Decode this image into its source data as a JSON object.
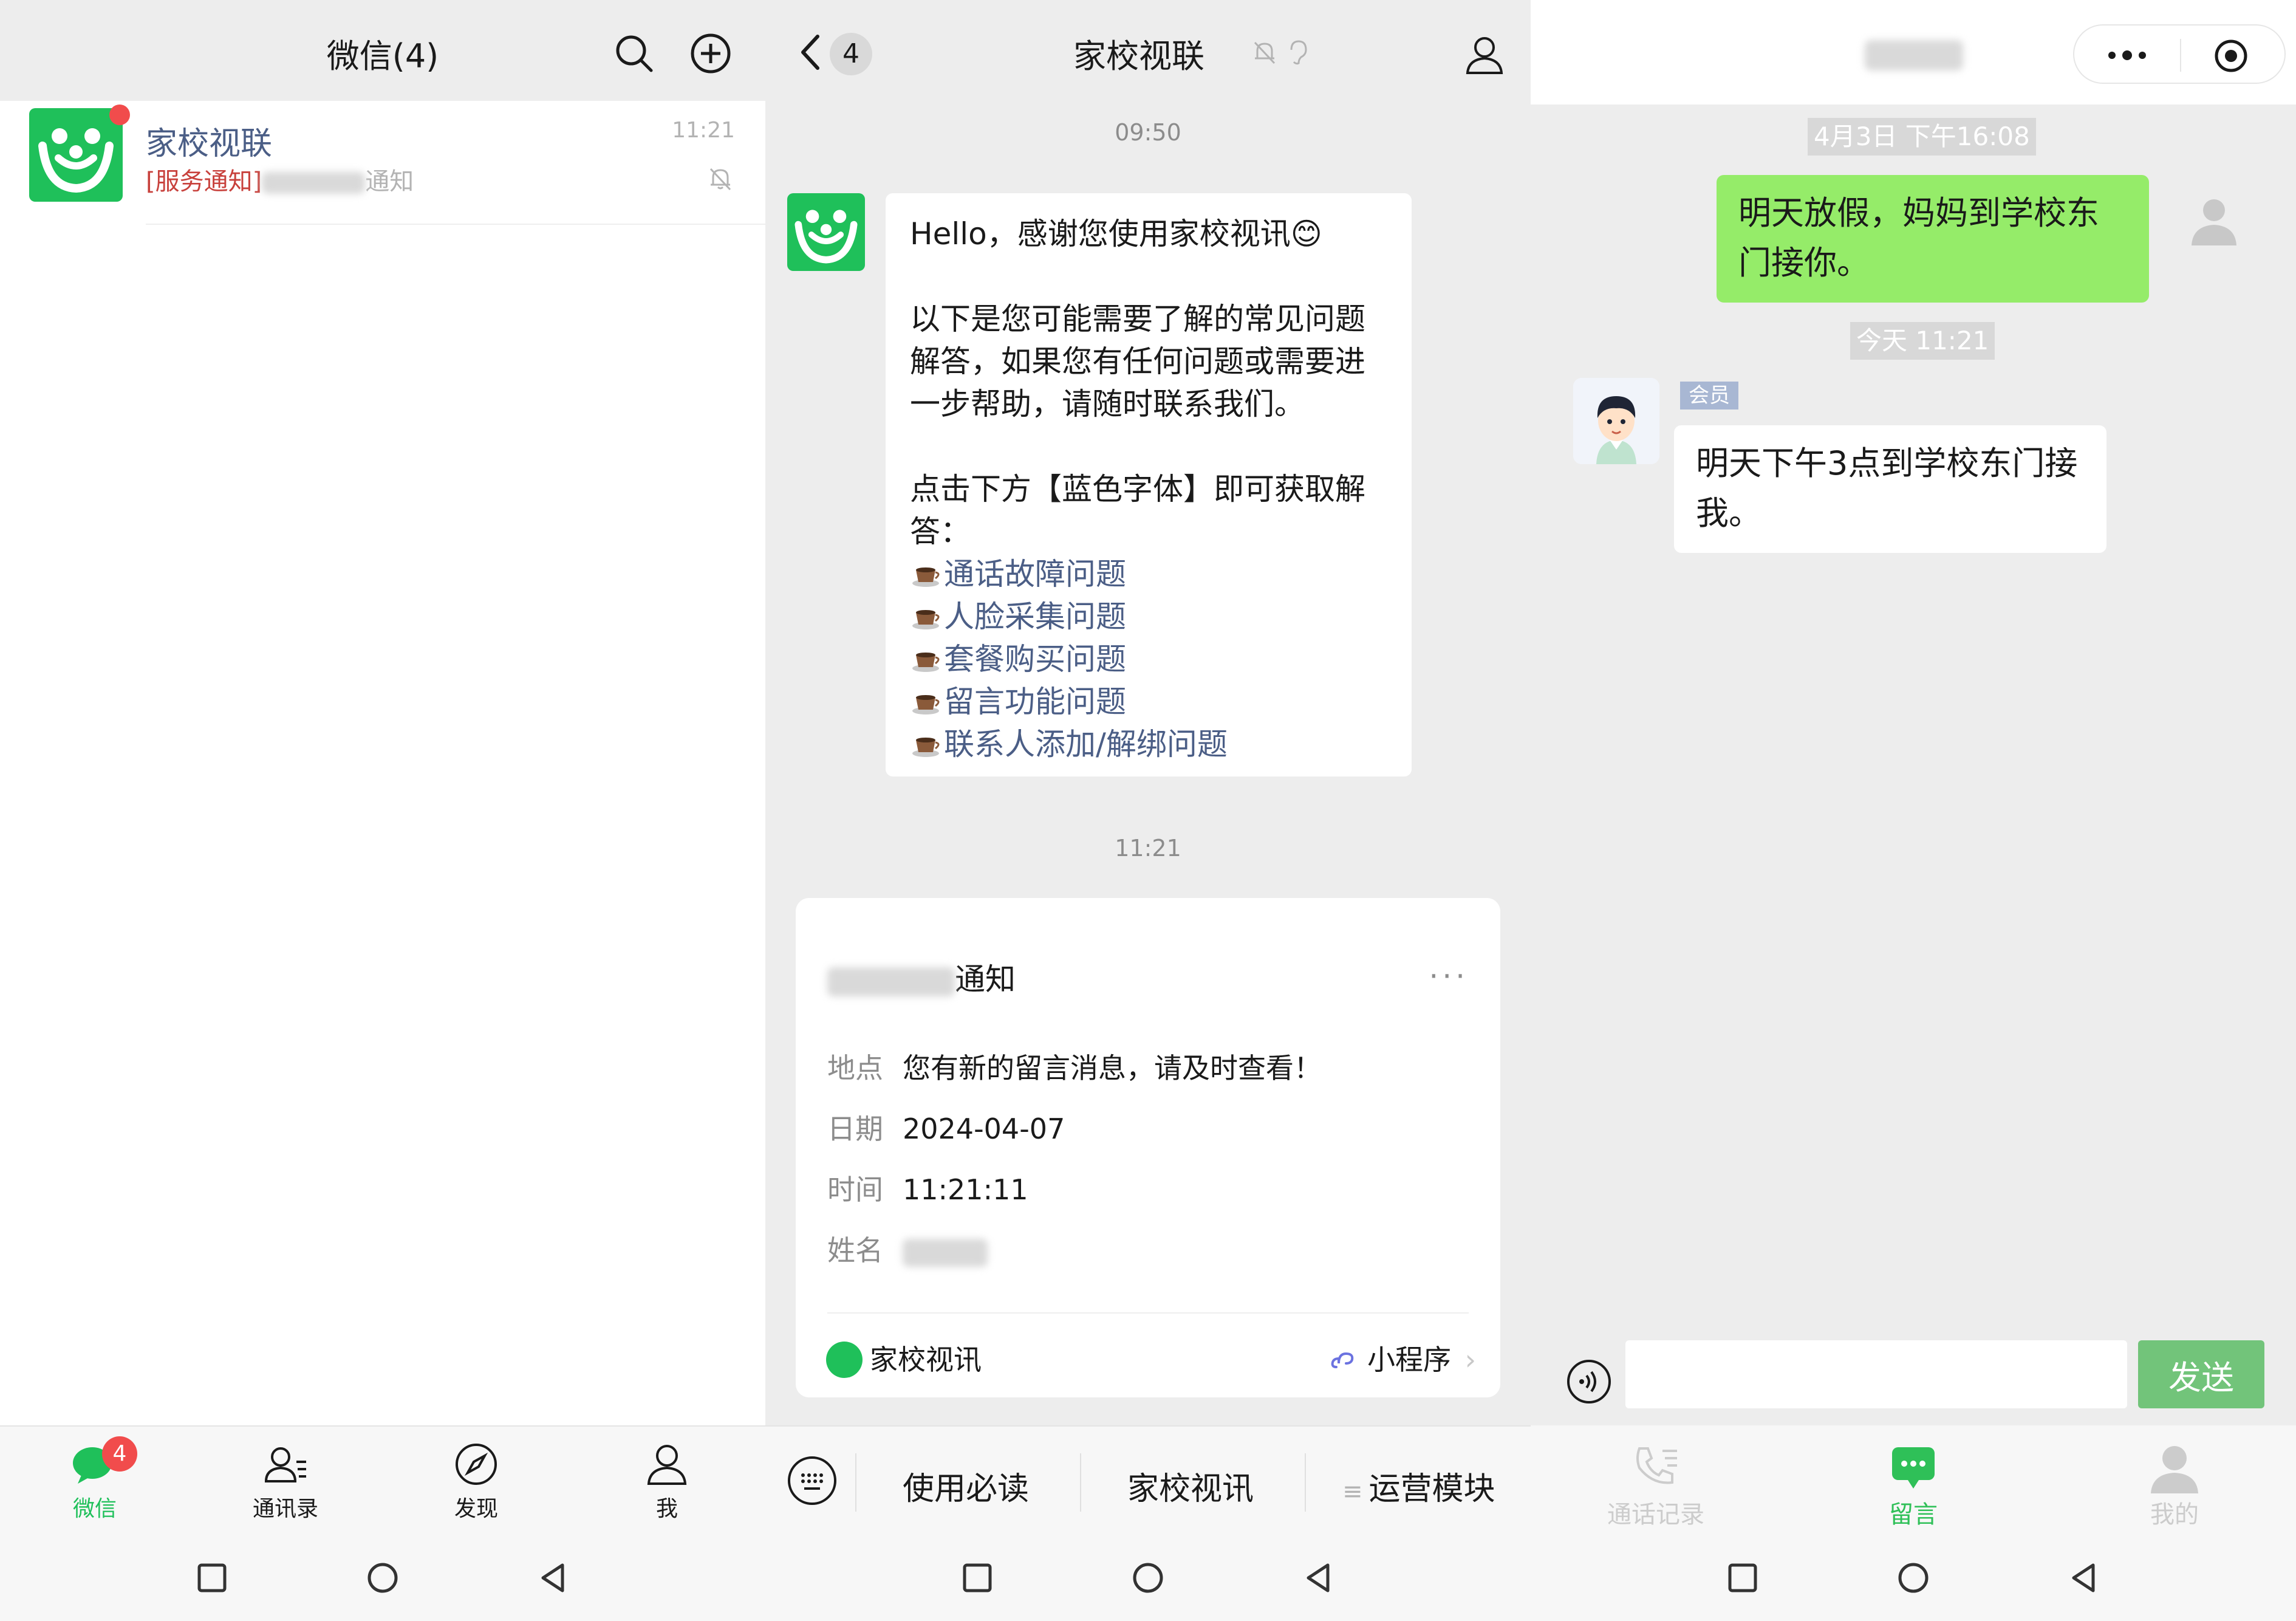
{
  "panel1": {
    "title": "微信(4)",
    "chat": {
      "name": "家校视联",
      "preview_tag": "[服务通知]",
      "preview_suffix": "通知",
      "time": "11:21"
    },
    "tabs": [
      {
        "label": "微信",
        "badge": "4"
      },
      {
        "label": "通讯录"
      },
      {
        "label": "发现"
      },
      {
        "label": "我"
      }
    ]
  },
  "panel2": {
    "back_count": "4",
    "title": "家校视联",
    "time1": "09:50",
    "greeting": "Hello，感谢您使用家校视讯😊",
    "intro": "以下是您可能需要了解的常见问题解答，如果您有任何问题或需要进一步帮助，请随时联系我们。",
    "prompt": "点击下方【蓝色字体】即可获取解答：",
    "links": [
      "通话故障问题",
      "人脸采集问题",
      "套餐购买问题",
      "留言功能问题",
      "联系人添加/解绑问题"
    ],
    "time2": "11:21",
    "card": {
      "title_suffix": "通知",
      "rows": [
        {
          "key": "地点",
          "value": "您有新的留言消息，请及时查看！"
        },
        {
          "key": "日期",
          "value": "2024-04-07"
        },
        {
          "key": "时间",
          "value": "11:21:11"
        },
        {
          "key": "姓名",
          "value": ""
        }
      ],
      "source": "家校视讯",
      "miniapp": "小程序"
    },
    "menu": [
      "使用必读",
      "家校视讯",
      "运营模块"
    ]
  },
  "panel3": {
    "ts1": "4月3日 下午16:08",
    "sent_message": "明天放假，妈妈到学校东门接你。",
    "ts2": "今天 11:21",
    "member_tag": "会员",
    "received_message": "明天下午3点到学校东门接我。",
    "send_label": "发送",
    "tabs": [
      {
        "label": "通话记录"
      },
      {
        "label": "留言"
      },
      {
        "label": "我的"
      }
    ]
  },
  "colors": {
    "wechat_green": "#1fc05a",
    "sent_bubble": "#95ec69",
    "send_button": "#72c47a",
    "link_blue": "#4b5e86",
    "badge_red": "#f14c4c"
  }
}
